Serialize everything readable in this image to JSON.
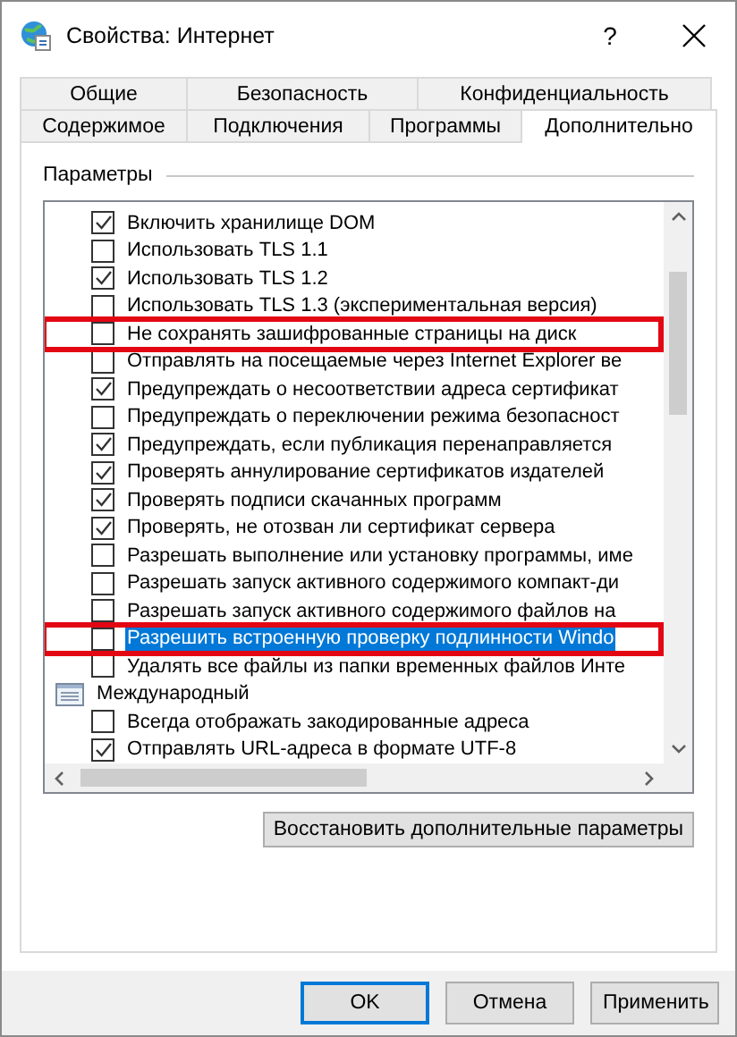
{
  "window": {
    "title": "Свойства: Интернет",
    "help": "?"
  },
  "tabs": [
    [
      {
        "label": "Общие",
        "selected": false
      },
      {
        "label": "Безопасность",
        "selected": false
      },
      {
        "label": "Конфиденциальность",
        "selected": false
      }
    ],
    [
      {
        "label": "Содержимое",
        "selected": false
      },
      {
        "label": "Подключения",
        "selected": false
      },
      {
        "label": "Программы",
        "selected": false
      },
      {
        "label": "Дополнительно",
        "selected": true
      }
    ]
  ],
  "group": {
    "title": "Параметры"
  },
  "options": [
    {
      "kind": "checkbox",
      "label": "Включить хранилище DOM",
      "checked": true,
      "selected": false,
      "highlighted": false
    },
    {
      "kind": "checkbox",
      "label": "Использовать TLS 1.1",
      "checked": false,
      "selected": false,
      "highlighted": false
    },
    {
      "kind": "checkbox",
      "label": "Использовать TLS 1.2",
      "checked": true,
      "selected": false,
      "highlighted": false
    },
    {
      "kind": "checkbox",
      "label": "Использовать TLS 1.3 (экспериментальная версия)",
      "checked": false,
      "selected": false,
      "highlighted": false
    },
    {
      "kind": "checkbox",
      "label": "Не сохранять зашифрованные страницы на диск",
      "checked": false,
      "selected": false,
      "highlighted": true
    },
    {
      "kind": "checkbox",
      "label": "Отправлять на посещаемые через Internet Explorer ве",
      "checked": false,
      "selected": false,
      "highlighted": false
    },
    {
      "kind": "checkbox",
      "label": "Предупреждать о несоответствии адреса сертификат",
      "checked": true,
      "selected": false,
      "highlighted": false
    },
    {
      "kind": "checkbox",
      "label": "Предупреждать о переключении режима безопасност",
      "checked": false,
      "selected": false,
      "highlighted": false
    },
    {
      "kind": "checkbox",
      "label": "Предупреждать, если публикация перенаправляется",
      "checked": true,
      "selected": false,
      "highlighted": false
    },
    {
      "kind": "checkbox",
      "label": "Проверять аннулирование сертификатов издателей",
      "checked": true,
      "selected": false,
      "highlighted": false
    },
    {
      "kind": "checkbox",
      "label": "Проверять подписи скачанных программ",
      "checked": true,
      "selected": false,
      "highlighted": false
    },
    {
      "kind": "checkbox",
      "label": "Проверять, не отозван ли сертификат сервера",
      "checked": true,
      "selected": false,
      "highlighted": false
    },
    {
      "kind": "checkbox",
      "label": "Разрешать выполнение или установку программы, име",
      "checked": false,
      "selected": false,
      "highlighted": false
    },
    {
      "kind": "checkbox",
      "label": "Разрешать запуск активного содержимого компакт-ди",
      "checked": false,
      "selected": false,
      "highlighted": false
    },
    {
      "kind": "checkbox",
      "label": "Разрешать запуск активного содержимого файлов на",
      "checked": false,
      "selected": false,
      "highlighted": false
    },
    {
      "kind": "checkbox",
      "label": "Разрешить встроенную проверку подлинности Windo",
      "checked": false,
      "selected": true,
      "highlighted": true
    },
    {
      "kind": "checkbox",
      "label": "Удалять все файлы из папки временных файлов Инте",
      "checked": false,
      "selected": false,
      "highlighted": false
    },
    {
      "kind": "category",
      "label": "Международный"
    },
    {
      "kind": "checkbox",
      "label": "Всегда отображать закодированные адреса",
      "checked": false,
      "selected": false,
      "highlighted": false
    },
    {
      "kind": "checkbox",
      "label": "Отправлять URL-адреса в формате UTF-8",
      "checked": true,
      "selected": false,
      "highlighted": false
    }
  ],
  "reset_button": "Восстановить дополнительные параметры",
  "buttons": [
    {
      "label": "OK",
      "default": true
    },
    {
      "label": "Отмена",
      "default": false
    },
    {
      "label": "Применить",
      "default": false
    }
  ]
}
